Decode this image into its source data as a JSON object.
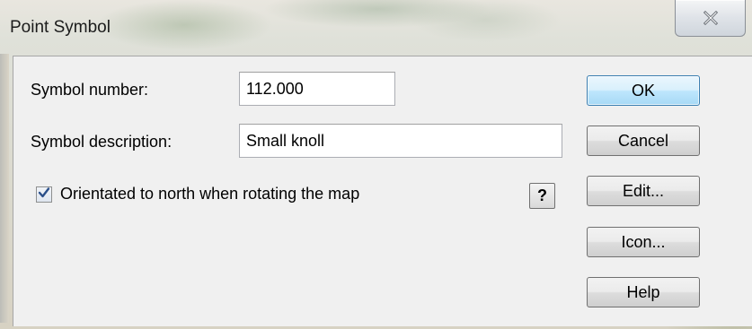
{
  "window": {
    "title": "Point Symbol"
  },
  "form": {
    "symbol_number_label": "Symbol number:",
    "symbol_number_value": "112.000",
    "symbol_description_label": "Symbol description:",
    "symbol_description_value": "Small knoll",
    "orient_checkbox_label": "Orientated to north when rotating the map",
    "orient_checked": true,
    "help_glyph": "?"
  },
  "buttons": {
    "ok": "OK",
    "cancel": "Cancel",
    "edit": "Edit...",
    "icon": "Icon...",
    "help": "Help"
  },
  "icons": {
    "close": "close-icon",
    "check": "checkmark-icon",
    "help": "question-mark-icon"
  },
  "colors": {
    "default_button_border": "#3c7fb1",
    "checkmark": "#2a4f8a"
  }
}
